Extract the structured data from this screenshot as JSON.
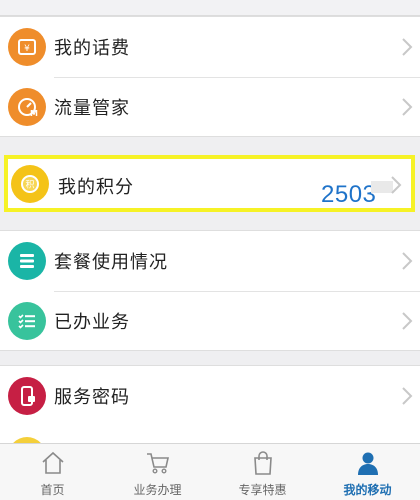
{
  "menu": {
    "phone_bill": "我的话费",
    "data_manager": "流量管家",
    "points_label": "我的积分",
    "points_value": "2503",
    "package_usage": "套餐使用情况",
    "completed_services": "已办业务",
    "service_password": "服务密码"
  },
  "tabs": [
    {
      "label": "首页"
    },
    {
      "label": "业务办理"
    },
    {
      "label": "专享特惠"
    },
    {
      "label": "我的移动"
    }
  ],
  "colors": {
    "orange_icon": "#ef8d2b",
    "teal_icon": "#1ab5a6",
    "green_icon": "#38c39c",
    "red_icon": "#c61f44",
    "gold_icon": "#f4c318",
    "highlight": "#f6f226",
    "value_blue": "#1f73c9",
    "tab_active": "#1f6fb2"
  },
  "icons": {
    "phone_bill": "yen-card-icon",
    "data_manager": "gauge-icon",
    "points": "points-coin-icon",
    "package_usage": "list-icon",
    "completed_services": "checklist-icon",
    "service_password": "phone-lock-icon",
    "tab_home": "home-icon",
    "tab_business": "cart-icon",
    "tab_offers": "shopping-bag-icon",
    "tab_my": "user-icon"
  }
}
